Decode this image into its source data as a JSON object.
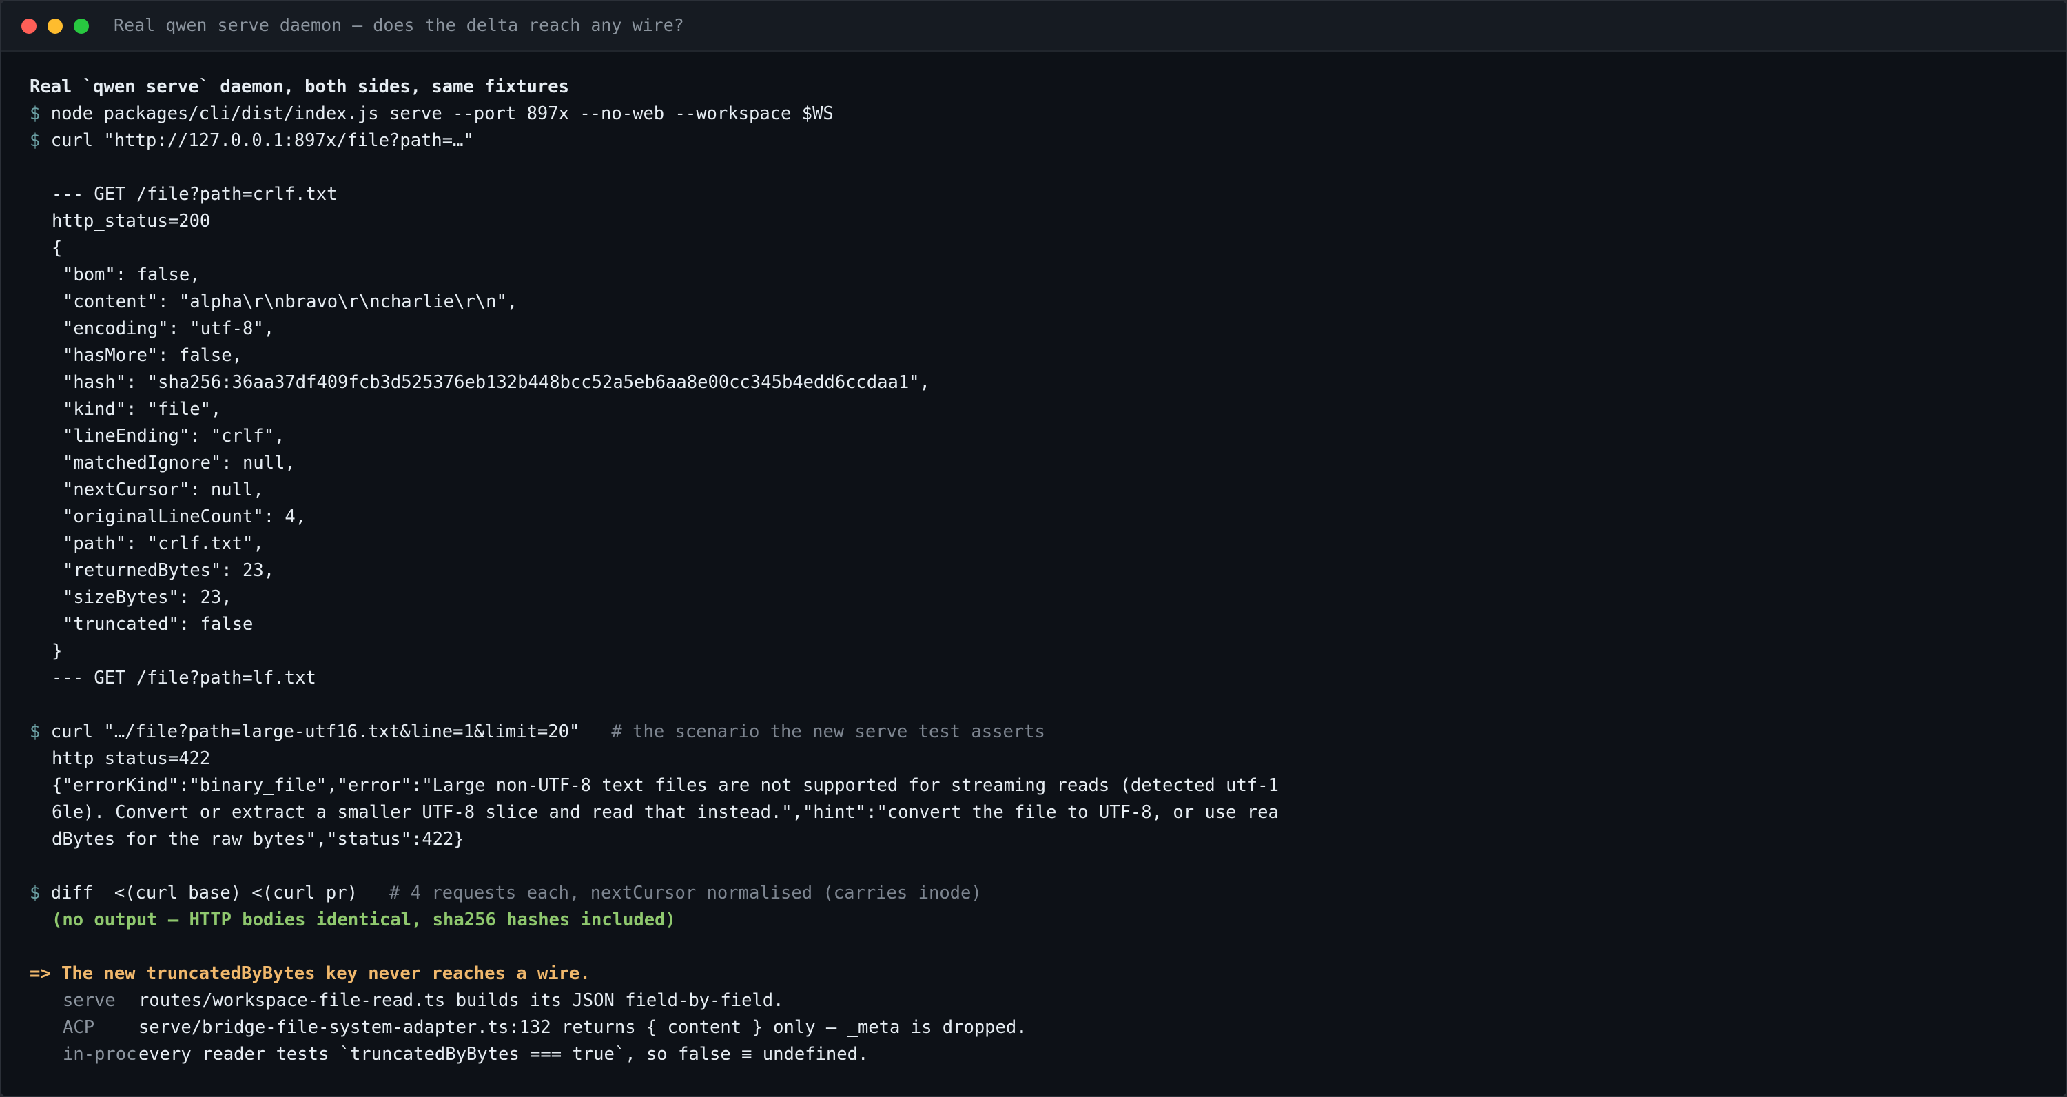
{
  "window": {
    "title": "Real qwen serve daemon — does the delta reach any wire?",
    "colors": {
      "close": "#ff5f57",
      "minimize": "#febc2e",
      "maximize": "#28c840"
    }
  },
  "terminal": {
    "heading": "Real `qwen serve` daemon, both sides, same fixtures",
    "prompt": "$",
    "cmd_serve": "node packages/cli/dist/index.js serve --port 897x --no-web --workspace $WS",
    "cmd_curl": "curl \"http://127.0.0.1:897x/file?path=…\"",
    "crlf": {
      "header": "--- GET /file?path=crlf.txt",
      "status": "http_status=200",
      "open": "{",
      "fields": [
        "\"bom\": false,",
        "\"content\": \"alpha\\r\\nbravo\\r\\ncharlie\\r\\n\",",
        "\"encoding\": \"utf-8\",",
        "\"hasMore\": false,",
        "\"hash\": \"sha256:36aa37df409fcb3d525376eb132b448bcc52a5eb6aa8e00cc345b4edd6ccdaa1\",",
        "\"kind\": \"file\",",
        "\"lineEnding\": \"crlf\",",
        "\"matchedIgnore\": null,",
        "\"nextCursor\": null,",
        "\"originalLineCount\": 4,",
        "\"path\": \"crlf.txt\",",
        "\"returnedBytes\": 23,",
        "\"sizeBytes\": 23,",
        "\"truncated\": false"
      ],
      "close": "}",
      "next_header": "--- GET /file?path=lf.txt"
    },
    "utf16": {
      "cmd": "curl \"…/file?path=large-utf16.txt&line=1&limit=20\"",
      "comment": "# the scenario the new serve test asserts",
      "status": "http_status=422",
      "body": [
        "{\"errorKind\":\"binary_file\",\"error\":\"Large non-UTF-8 text files are not supported for streaming reads (detected utf-1",
        "6le). Convert or extract a smaller UTF-8 slice and read that instead.\",\"hint\":\"convert the file to UTF-8, or use rea",
        "dBytes for the raw bytes\",\"status\":422}"
      ]
    },
    "diff": {
      "cmd": "diff  <(curl base) <(curl pr)",
      "comment": "# 4 requests each, nextCursor normalised (carries inode)",
      "result": "(no output — HTTP bodies identical, sha256 hashes included)"
    },
    "conclusion": {
      "headline": "=> The new truncatedByBytes key never reaches a wire.",
      "rows": [
        {
          "tag": "serve",
          "text": "routes/workspace-file-read.ts builds its JSON field-by-field."
        },
        {
          "tag": "ACP",
          "text": "serve/bridge-file-system-adapter.ts:132 returns { content } only — _meta is dropped."
        },
        {
          "tag": "in-proc",
          "text": "every reader tests `truncatedByBytes === true`, so false ≡ undefined."
        }
      ]
    }
  }
}
